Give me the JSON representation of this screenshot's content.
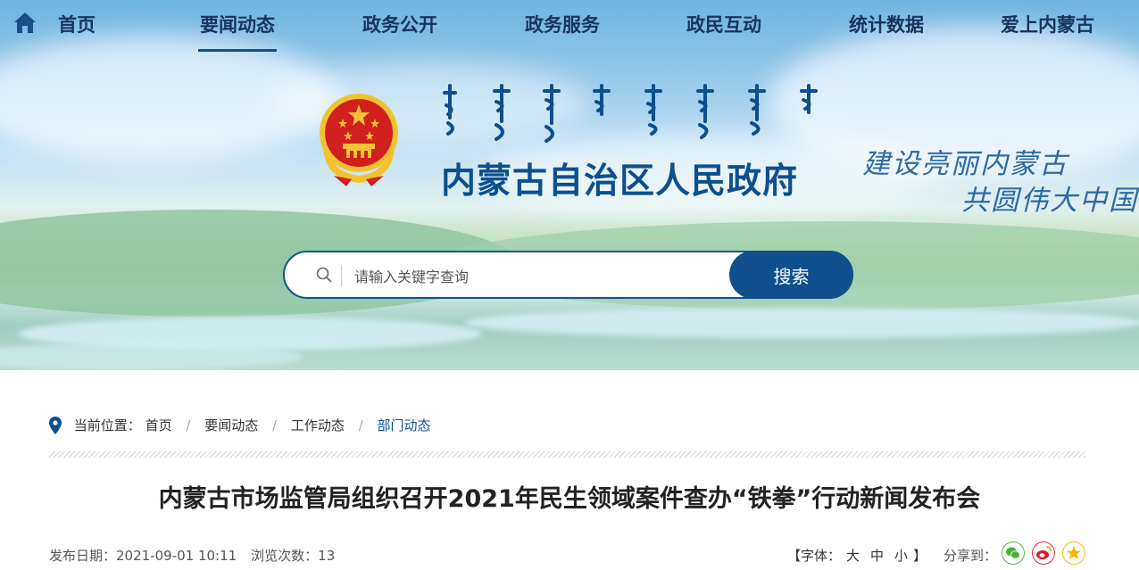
{
  "nav": {
    "home_icon": "home-icon",
    "items": [
      {
        "label": "首页",
        "active": false
      },
      {
        "label": "要闻动态",
        "active": true
      },
      {
        "label": "政务公开",
        "active": false
      },
      {
        "label": "政务服务",
        "active": false
      },
      {
        "label": "政民互动",
        "active": false
      },
      {
        "label": "统计数据",
        "active": false
      },
      {
        "label": "爱上内蒙古",
        "active": false
      }
    ]
  },
  "header": {
    "mongolian_title": "ᠦᠪᠦᠷ ᠮᠣᠩᠭᠣᠯ",
    "site_title": "内蒙古自治区人民政府",
    "slogan_line1": "建设亮丽内蒙古",
    "slogan_line2": "共圆伟大中国梦"
  },
  "search": {
    "placeholder": "请输入关键字查询",
    "value": "",
    "button_label": "搜索"
  },
  "breadcrumb": {
    "prefix": "当前位置：",
    "items": [
      "首页",
      "要闻动态",
      "工作动态",
      "部门动态"
    ]
  },
  "article": {
    "title": "内蒙古市场监管局组织召开2021年民生领域案件查办“铁拳”行动新闻发布会",
    "publish_date": "发布日期：2021-09-01 10:11",
    "views": "浏览次数：13"
  },
  "font_size": {
    "open": "【字体：",
    "large": "大",
    "medium": "中",
    "small": "小",
    "close": "】"
  },
  "share": {
    "label": "分享到：",
    "icons": [
      "wechat-icon",
      "weibo-icon",
      "qzone-icon"
    ]
  },
  "colors": {
    "brand": "#0f4f8c",
    "nav_text": "#17355f",
    "emblem_red": "#d21f1f",
    "emblem_gold": "#f2c230"
  }
}
